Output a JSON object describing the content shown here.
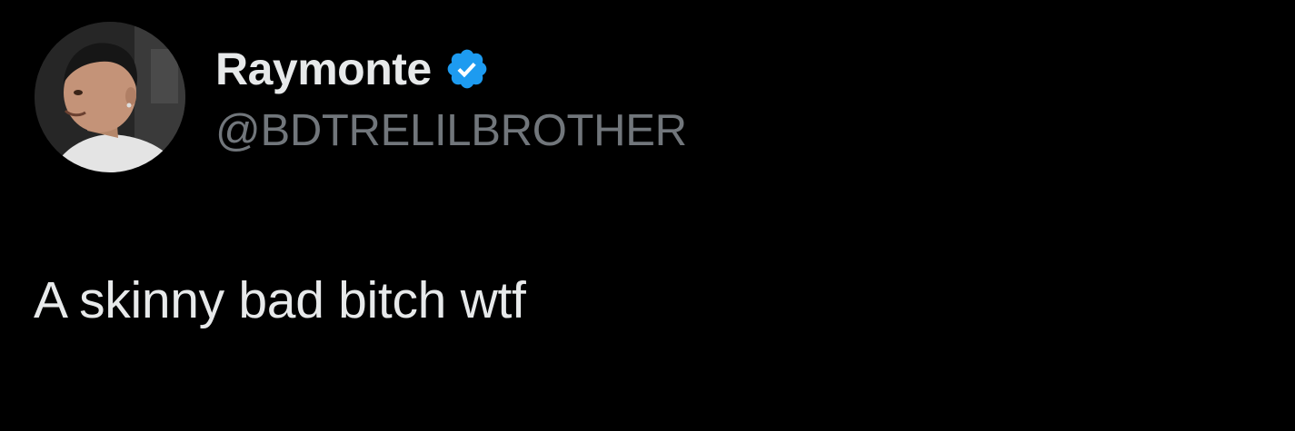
{
  "tweet": {
    "author": {
      "display_name": "Raymonte",
      "handle": "@BDTRELILBROTHER",
      "verified": true,
      "avatar_icon": "profile-photo"
    },
    "text": "A skinny bad bitch wtf",
    "colors": {
      "background": "#000000",
      "primary_text": "#e7e9ea",
      "secondary_text": "#71767b",
      "verified_badge": "#1d9bf0"
    }
  }
}
